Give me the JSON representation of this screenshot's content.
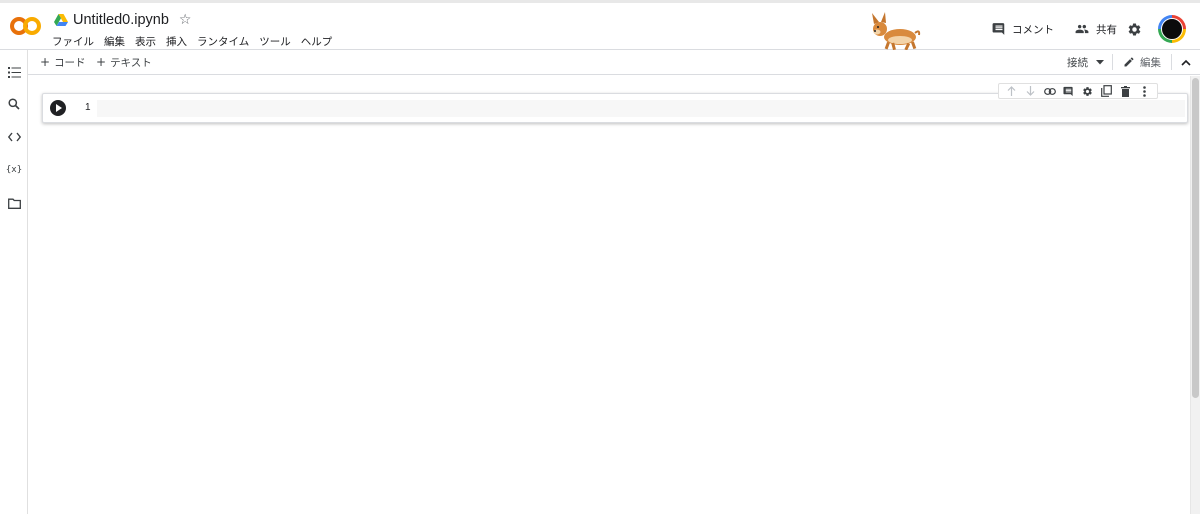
{
  "header": {
    "notebook_title": "Untitled0.ipynb",
    "star_glyph": "☆",
    "menu": [
      "ファイル",
      "編集",
      "表示",
      "挿入",
      "ランタイム",
      "ツール",
      "ヘルプ"
    ],
    "comment_label": "コメント",
    "share_label": "共有"
  },
  "sidebar": {
    "items": [
      {
        "icon": "table-of-contents-icon"
      },
      {
        "icon": "search-icon"
      },
      {
        "icon": "code-snippets-icon"
      },
      {
        "icon": "variables-icon",
        "text": "{x}"
      },
      {
        "icon": "folder-icon"
      }
    ]
  },
  "toolbar": {
    "add_code_label": "コード",
    "add_text_label": "テキスト",
    "plus_glyph": "+",
    "connect_label": "接続",
    "edit_label": "編集"
  },
  "cell": {
    "line_number": "1",
    "tools": [
      "arrow-up-icon",
      "arrow-down-icon",
      "link-icon",
      "comment-icon",
      "settings-icon",
      "mirror-cell-icon",
      "delete-icon",
      "more-vert-icon"
    ]
  },
  "colors": {
    "logo_orange": "#F9AB00",
    "logo_dark_orange": "#E8710A",
    "avatar_ring": "#4285f4"
  }
}
